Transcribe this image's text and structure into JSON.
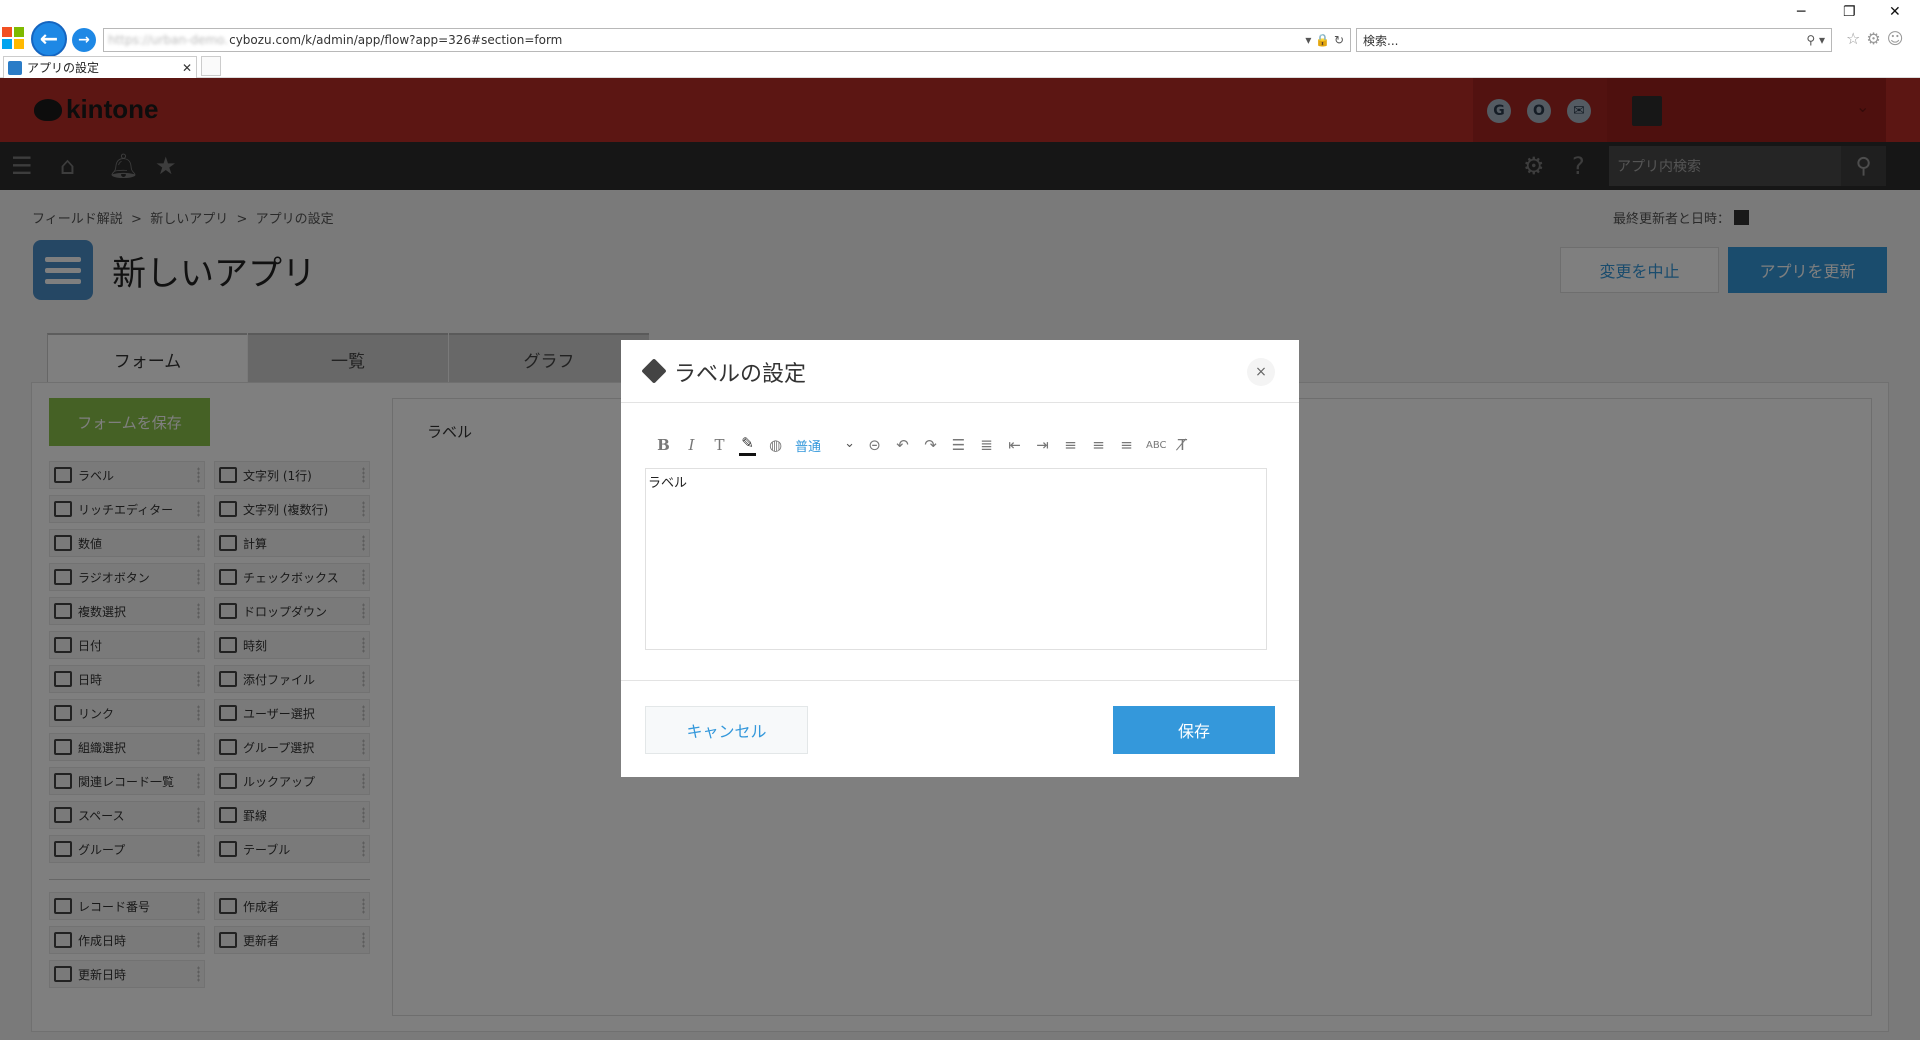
{
  "browser": {
    "address_prefix": "https://urban-demo.",
    "address_host": "cybozu.com",
    "address_path": "/k/admin/app/flow?app=326#section=form",
    "search_placeholder": "検索...",
    "tab_title": "アプリの設定",
    "colors": {
      "nav_button": "#1e88e5"
    }
  },
  "header": {
    "logo": "kintone",
    "services": [
      "G",
      "O",
      "✉"
    ],
    "colors": {
      "header_bg": "#b82c26",
      "nav_bg": "#2d2d2d"
    }
  },
  "nav": {
    "app_search_placeholder": "アプリ内検索",
    "icons": [
      "menu-icon",
      "home-icon",
      "bell-icon",
      "star-icon",
      "gear-icon",
      "help-icon",
      "search-icon"
    ]
  },
  "breadcrumb": [
    "フィールド解説",
    "新しいアプリ",
    "アプリの設定"
  ],
  "breadcrumb_sep": ">",
  "updated_label": "最終更新者と日時：",
  "app": {
    "title": "新しいアプリ",
    "cancel_change": "変更を中止",
    "update_app": "アプリを更新"
  },
  "tabs": [
    "フォーム",
    "一覧",
    "グラフ"
  ],
  "form": {
    "save_form": "フォームを保存",
    "canvas_label": "ラベル"
  },
  "palette": [
    {
      "label": "ラベル",
      "icon": "tag-icon"
    },
    {
      "label": "文字列 (1行)",
      "icon": "abc-icon"
    },
    {
      "label": "リッチエディター",
      "icon": "rich-editor-icon"
    },
    {
      "label": "文字列 (複数行)",
      "icon": "multiline-icon"
    },
    {
      "label": "数値",
      "icon": "number-icon"
    },
    {
      "label": "計算",
      "icon": "calculator-icon"
    },
    {
      "label": "ラジオボタン",
      "icon": "radio-icon"
    },
    {
      "label": "チェックボックス",
      "icon": "checkbox-icon"
    },
    {
      "label": "複数選択",
      "icon": "multi-select-icon"
    },
    {
      "label": "ドロップダウン",
      "icon": "dropdown-icon"
    },
    {
      "label": "日付",
      "icon": "calendar-icon"
    },
    {
      "label": "時刻",
      "icon": "clock-icon"
    },
    {
      "label": "日時",
      "icon": "calendar-icon"
    },
    {
      "label": "添付ファイル",
      "icon": "paperclip-icon"
    },
    {
      "label": "リンク",
      "icon": "globe-icon"
    },
    {
      "label": "ユーザー選択",
      "icon": "user-icon"
    },
    {
      "label": "組織選択",
      "icon": "org-icon"
    },
    {
      "label": "グループ選択",
      "icon": "group-icon"
    },
    {
      "label": "関連レコード一覧",
      "icon": "related-records-icon"
    },
    {
      "label": "ルックアップ",
      "icon": "lookup-icon"
    },
    {
      "label": "スペース",
      "icon": "space-icon"
    },
    {
      "label": "罫線",
      "icon": "line-icon"
    },
    {
      "label": "グループ",
      "icon": "group-field-icon"
    },
    {
      "label": "テーブル",
      "icon": "table-icon"
    }
  ],
  "palette_system": [
    {
      "label": "レコード番号",
      "icon": "number-icon"
    },
    {
      "label": "作成者",
      "icon": "user-icon"
    },
    {
      "label": "作成日時",
      "icon": "calendar-icon"
    },
    {
      "label": "更新者",
      "icon": "user-icon"
    },
    {
      "label": "更新日時",
      "icon": "calendar-icon"
    }
  ],
  "dialog": {
    "title": "ラベルの設定",
    "close": "×",
    "font_size": "普通",
    "toolbar": [
      "bold-icon",
      "italic-icon",
      "text-format-icon",
      "text-color-icon",
      "background-color-icon",
      "font-size-select",
      "link-icon",
      "undo-icon",
      "redo-icon",
      "bullet-list-icon",
      "numbered-list-icon",
      "outdent-icon",
      "indent-icon",
      "align-left-icon",
      "align-center-icon",
      "align-right-icon",
      "strikethrough-icon",
      "clear-format-icon"
    ],
    "editor_text": "ラベル",
    "cancel": "キャンセル",
    "save": "保存",
    "colors": {
      "primary": "#3498db"
    }
  }
}
